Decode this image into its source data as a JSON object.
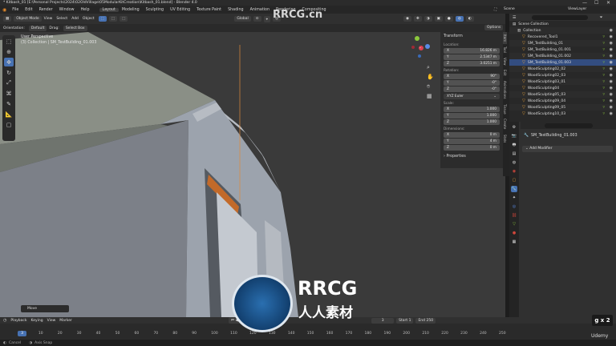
{
  "window": {
    "title": "* Kitbash_01 [E:\\Personal Projects\\2024\\02OldVillage\\05ModularKitCreation\\Kitbash_01.blend] - Blender 4.0",
    "controls": [
      "—",
      "☐",
      "✕"
    ]
  },
  "menubar": {
    "items": [
      "File",
      "Edit",
      "Render",
      "Window",
      "Help"
    ],
    "workspaces": [
      "Layout",
      "Modeling",
      "Sculpting",
      "UV Editing",
      "Texture Paint",
      "Shading",
      "Animation",
      "Rendering",
      "Compositing"
    ],
    "active_workspace": "Layout",
    "scene_label": "Scene",
    "viewlayer_label": "ViewLayer"
  },
  "header": {
    "mode": "Object Mode",
    "menus": [
      "View",
      "Select",
      "Add",
      "Object"
    ],
    "transform_orientation": "Global",
    "options": "Options"
  },
  "subheader": {
    "orientation_label": "Orientation:",
    "orientation_value": "Default",
    "drag_label": "Drag:",
    "drag_value": "Select Box"
  },
  "viewport": {
    "perspective": "User Perspective",
    "collection_path": "(3) Collection | SM_TestBuilding_01.003",
    "operator_panel": "Move"
  },
  "npanel": {
    "section": "Transform",
    "location_label": "Location:",
    "location": [
      {
        "axis": "X",
        "value": "16.826 m"
      },
      {
        "axis": "Y",
        "value": "2.5347 m"
      },
      {
        "axis": "Z",
        "value": "3.0251 m"
      }
    ],
    "rotation_label": "Rotation:",
    "rotation": [
      {
        "axis": "X",
        "value": "90°"
      },
      {
        "axis": "Y",
        "value": "-0°"
      },
      {
        "axis": "Z",
        "value": "-0°"
      }
    ],
    "rotation_mode": "XYZ Euler",
    "scale_label": "Scale:",
    "scale": [
      {
        "axis": "X",
        "value": "1.000"
      },
      {
        "axis": "Y",
        "value": "1.000"
      },
      {
        "axis": "Z",
        "value": "1.000"
      }
    ],
    "dimensions_label": "Dimensions:",
    "dimensions": [
      {
        "axis": "X",
        "value": "0 m"
      },
      {
        "axis": "Y",
        "value": "4 m"
      },
      {
        "axis": "Z",
        "value": "0 m"
      }
    ],
    "properties_section": "Properties",
    "side_tabs": [
      "Item",
      "Tool",
      "View",
      "Edit",
      "Animations",
      "Tissue",
      "Create",
      "Stats"
    ]
  },
  "outliner": {
    "root": "Scene Collection",
    "collection": "Collection",
    "items": [
      {
        "name": "Recovered_Tool1",
        "selected": false
      },
      {
        "name": "SM_TestBuilding_01",
        "selected": false
      },
      {
        "name": "SM_TestBuilding_01.001",
        "selected": false
      },
      {
        "name": "SM_TestBuilding_01.002",
        "selected": false
      },
      {
        "name": "SM_TestBuilding_01.003",
        "selected": true
      },
      {
        "name": "WoodSculpting02_02",
        "selected": false
      },
      {
        "name": "WoodSculpting02_03",
        "selected": false
      },
      {
        "name": "WoodSculpting03_01",
        "selected": false
      },
      {
        "name": "WoodSculpting04",
        "selected": false
      },
      {
        "name": "WoodSculpting05_03",
        "selected": false
      },
      {
        "name": "WoodSculpting09_04",
        "selected": false
      },
      {
        "name": "WoodSculpting09_05",
        "selected": false
      },
      {
        "name": "WoodSculpting10_03",
        "selected": false
      }
    ]
  },
  "properties": {
    "object_name": "SM_TestBuilding_01.003",
    "add_modifier": "Add Modifier"
  },
  "timeline": {
    "menus": [
      "Playback",
      "Keying",
      "View",
      "Marker"
    ],
    "current_frame": "3",
    "start_label": "Start",
    "start": "1",
    "end_label": "End",
    "end": "250",
    "ticks": [
      "10",
      "20",
      "30",
      "40",
      "50",
      "60",
      "70",
      "80",
      "90",
      "100",
      "110",
      "120",
      "130",
      "140",
      "150",
      "160",
      "170",
      "180",
      "190",
      "200",
      "210",
      "220",
      "230",
      "240",
      "250"
    ]
  },
  "status": {
    "cancel": "Cancel",
    "axis_snap": "Axis Snap"
  },
  "overlay": {
    "speed": "g x 2",
    "brand_logo": "RRCG",
    "brand_cn": "人人素材",
    "udemy": "Udemy",
    "watermark_top": "RRCG.cn"
  },
  "colors": {
    "accent_blue": "#4772b3",
    "selection": "#334d80",
    "active_orange": "#f0a63a",
    "viewport_bg": "#3a3a3a"
  }
}
